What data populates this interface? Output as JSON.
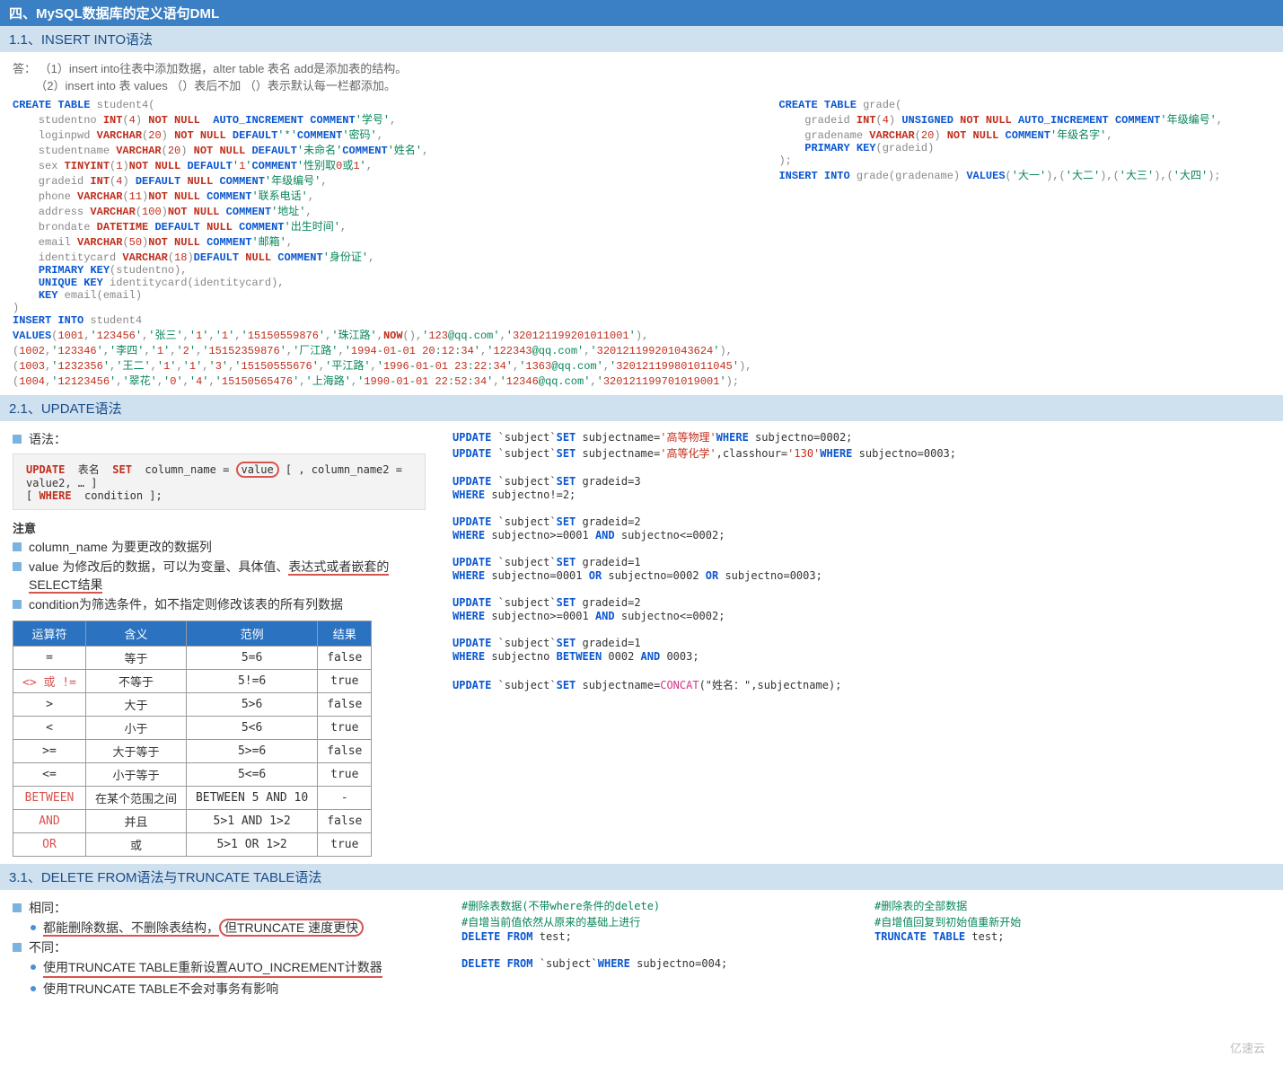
{
  "title": "四、MySQL数据库的定义语句DML",
  "s1": {
    "header": "1.1、INSERT INTO语法",
    "qlabel": "答：",
    "q1": "（1）insert into往表中添加数据，alter table 表名 add是添加表的结构。",
    "q2": "（2）insert into 表 values （）表后不加 （）表示默认每一栏都添加。",
    "code_left": "CREATE TABLE student4(\n    studentno INT(4) NOT NULL  AUTO_INCREMENT COMMENT'学号',\n    loginpwd VARCHAR(20) NOT NULL DEFAULT'*'COMMENT'密码',\n    studentname VARCHAR(20) NOT NULL DEFAULT'未命名'COMMENT'姓名',\n    sex TINYINT(1)NOT NULL DEFAULT'1'COMMENT'性别取0或1',\n    gradeid INT(4) DEFAULT NULL COMMENT'年级编号',\n    phone VARCHAR(11)NOT NULL COMMENT'联系电话',\n    address VARCHAR(100)NOT NULL COMMENT'地址',\n    brondate DATETIME DEFAULT NULL COMMENT'出生时间',\n    email VARCHAR(50)NOT NULL COMMENT'邮箱',\n    identitycard VARCHAR(18)DEFAULT NULL COMMENT'身份证',\n    PRIMARY KEY(studentno),\n    UNIQUE KEY identitycard(identitycard),\n    KEY email(email)\n)\nINSERT INTO student4\nVALUES(1001,'123456','张三','1','1','15150559876','珠江路',NOW(),'123@qq.com','320121199201011001'),\n(1002,'123346','李四','1','2','15152359876','厂江路','1994-01-01 20:12:34','122343@qq.com','320121199201043624'),\n(1003,'1232356','王二','1','1','3','15150555676','平江路','1996-01-01 23:22:34','1363@qq.com','320121199801011045'),\n(1004,'12123456','翠花','0','4','15150565476','上海路','1990-01-01 22:52:34','12346@qq.com','320121199701019001');",
    "code_right": "CREATE TABLE grade(\n    gradeid INT(4) UNSIGNED NOT NULL AUTO_INCREMENT COMMENT'年级编号',\n    gradename VARCHAR(20) NOT NULL COMMENT'年级名字',\n    PRIMARY KEY(gradeid)\n);\nINSERT INTO grade(gradename) VALUES('大一'),('大二'),('大三'),('大四');"
  },
  "s2": {
    "header": "2.1、UPDATE语法",
    "syntax_label": "语法：",
    "syntax_line1": "UPDATE  表名  SET  column_name = value [ , column_name2 = value2, … ]",
    "syntax_line2": "[ WHERE  condition ];",
    "note_label": "注意",
    "notes": [
      "column_name 为要更改的数据列",
      "value 为修改后的数据，可以为变量、具体值、表达式或者嵌套的SELECT结果",
      "condition为筛选条件，如不指定则修改该表的所有列数据"
    ],
    "table": {
      "headers": [
        "运算符",
        "含义",
        "范例",
        "结果"
      ],
      "rows": [
        [
          "=",
          "等于",
          "5=6",
          "false"
        ],
        [
          "<> 或 !=",
          "不等于",
          "5!=6",
          "true"
        ],
        [
          ">",
          "大于",
          "5>6",
          "false"
        ],
        [
          "<",
          "小于",
          "5<6",
          "true"
        ],
        [
          ">=",
          "大于等于",
          "5>=6",
          "false"
        ],
        [
          "<=",
          "小于等于",
          "5<=6",
          "true"
        ],
        [
          "BETWEEN",
          "在某个范围之间",
          "BETWEEN 5 AND 10",
          "-"
        ],
        [
          "AND",
          "并且",
          "5>1 AND 1>2",
          "false"
        ],
        [
          "OR",
          "或",
          "5>1 OR 1>2",
          "true"
        ]
      ]
    },
    "sql": [
      "UPDATE `subject`SET subjectname='高等物理'WHERE subjectno=0002;",
      "UPDATE `subject`SET subjectname='高等化学',classhour='130'WHERE subjectno=0003;",
      "",
      "UPDATE `subject`SET gradeid=3",
      "WHERE subjectno!=2;",
      "",
      "UPDATE `subject`SET gradeid=2",
      "WHERE subjectno>=0001 AND subjectno<=0002;",
      "",
      "UPDATE `subject`SET gradeid=1",
      "WHERE subjectno=0001 OR subjectno=0002 OR subjectno=0003;",
      "",
      "UPDATE `subject`SET gradeid=2",
      "WHERE subjectno>=0001 AND subjectno<=0002;",
      "",
      "UPDATE `subject`SET gradeid=1",
      "WHERE subjectno BETWEEN 0002 AND 0003;",
      "",
      "UPDATE `subject`SET subjectname=CONCAT(\"姓名：\",subjectname);"
    ]
  },
  "s3": {
    "header": "3.1、DELETE FROM语法与TRUNCATE TABLE语法",
    "same_label": "相同：",
    "same1": "都能删除数据、不删除表结构，但TRUNCATE 速度更快",
    "diff_label": "不同：",
    "diff1": "使用TRUNCATE TABLE重新设置AUTO_INCREMENT计数器",
    "diff2": "使用TRUNCATE TABLE不会对事务有影响",
    "colA": [
      "#删除表数据(不带where条件的delete)",
      "#自增当前值依然从原来的基础上进行",
      "DELETE FROM test;",
      "",
      "DELETE FROM `subject`WHERE subjectno=004;"
    ],
    "colB": [
      "#删除表的全部数据",
      "#自增值回复到初始值重新开始",
      "TRUNCATE TABLE test;"
    ]
  },
  "logo": "亿速云"
}
